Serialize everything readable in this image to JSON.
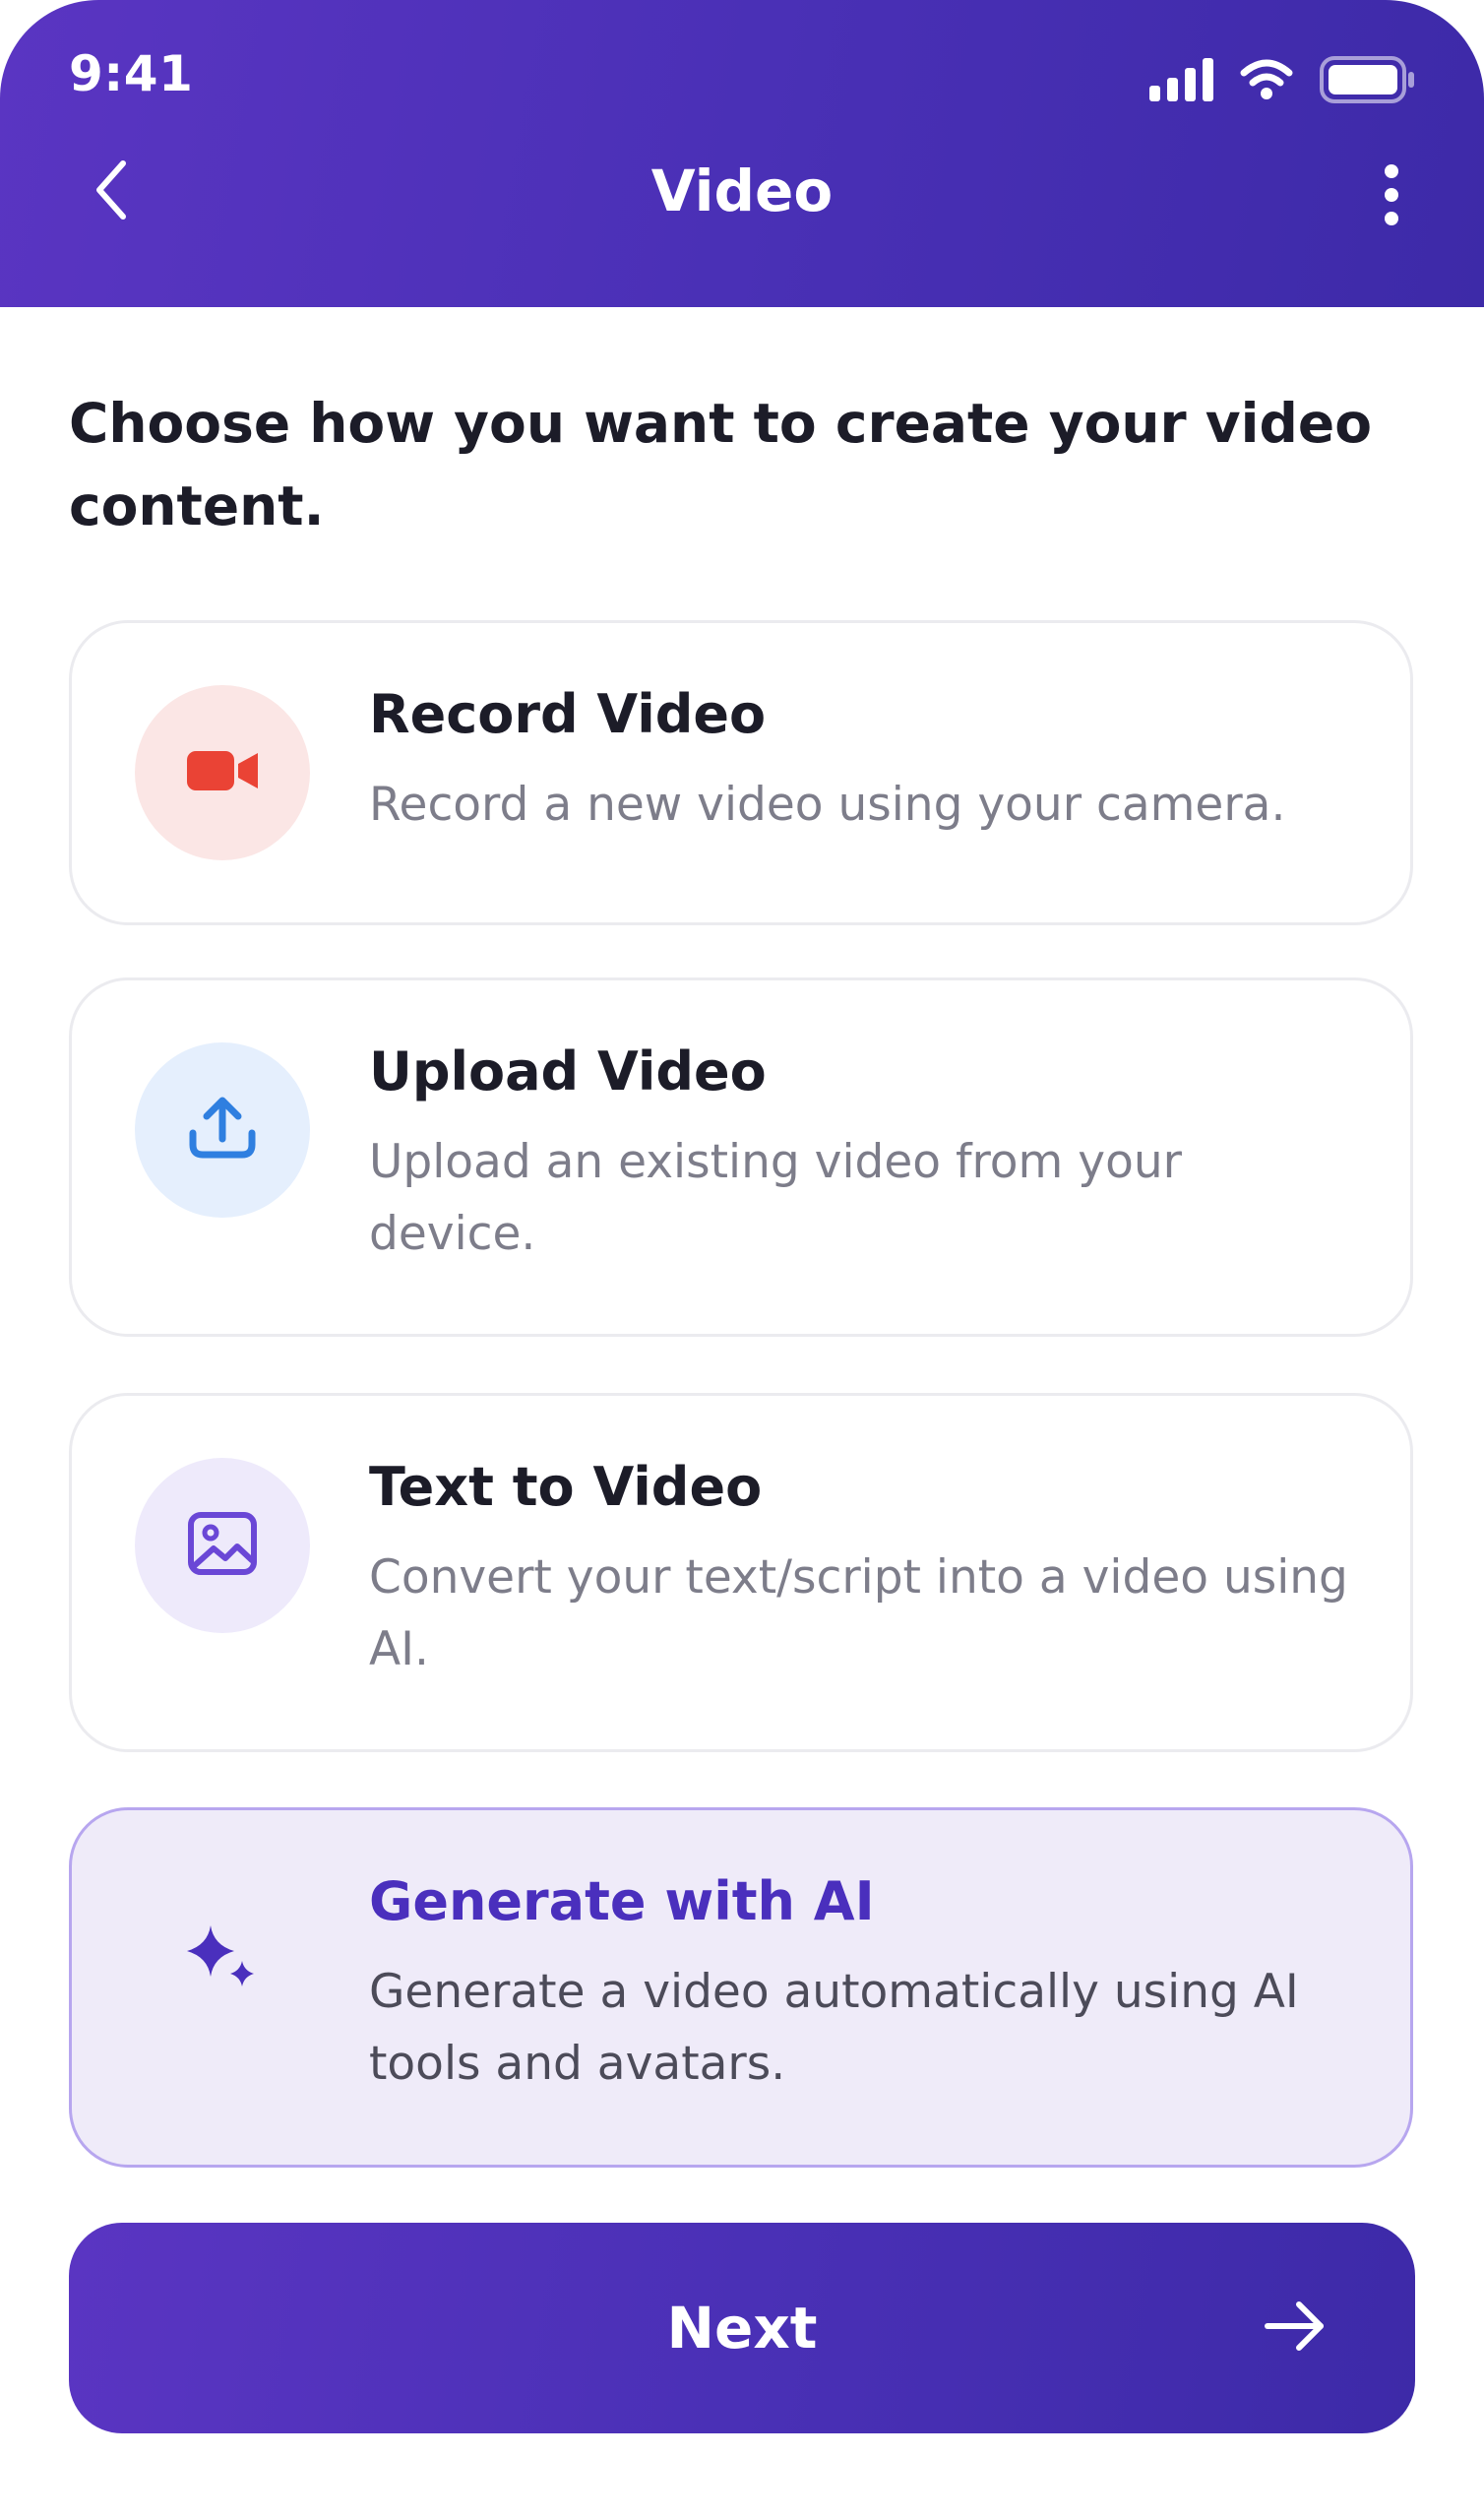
{
  "status_bar": {
    "time": "9:41",
    "icons": [
      "cellular-signal-icon",
      "wifi-icon",
      "battery-icon"
    ]
  },
  "header": {
    "title": "Video",
    "back_icon": "chevron-left-icon",
    "menu_icon": "more-vertical-icon"
  },
  "intro": "Choose how you want to create your video content.",
  "options": [
    {
      "title": "Record Video",
      "description": "Record a new video using your camera.",
      "icon": "video-camera-icon",
      "icon_color": "#ea4335",
      "icon_bg": "#fbe6e5",
      "selected": false
    },
    {
      "title": "Upload Video",
      "description": "Upload an existing video from your device.",
      "icon": "upload-icon",
      "icon_color": "#2f7fe0",
      "icon_bg": "#e5effd",
      "selected": false
    },
    {
      "title": "Text to Video",
      "description": "Convert your text/script into a video using AI.",
      "icon": "image-icon",
      "icon_color": "#6a47d6",
      "icon_bg": "#eeeafb",
      "selected": false
    },
    {
      "title": "Generate with AI",
      "description": "Generate a video automatically using AI tools and avatars.",
      "icon": "sparkles-icon",
      "icon_color": "#4a2fbd",
      "selected": true
    }
  ],
  "next_button": {
    "label": "Next",
    "icon": "arrow-right-icon"
  },
  "colors": {
    "brand_primary": "#4a30b6",
    "selected_border": "#b7a6ef",
    "selected_background": "#efebf9"
  }
}
